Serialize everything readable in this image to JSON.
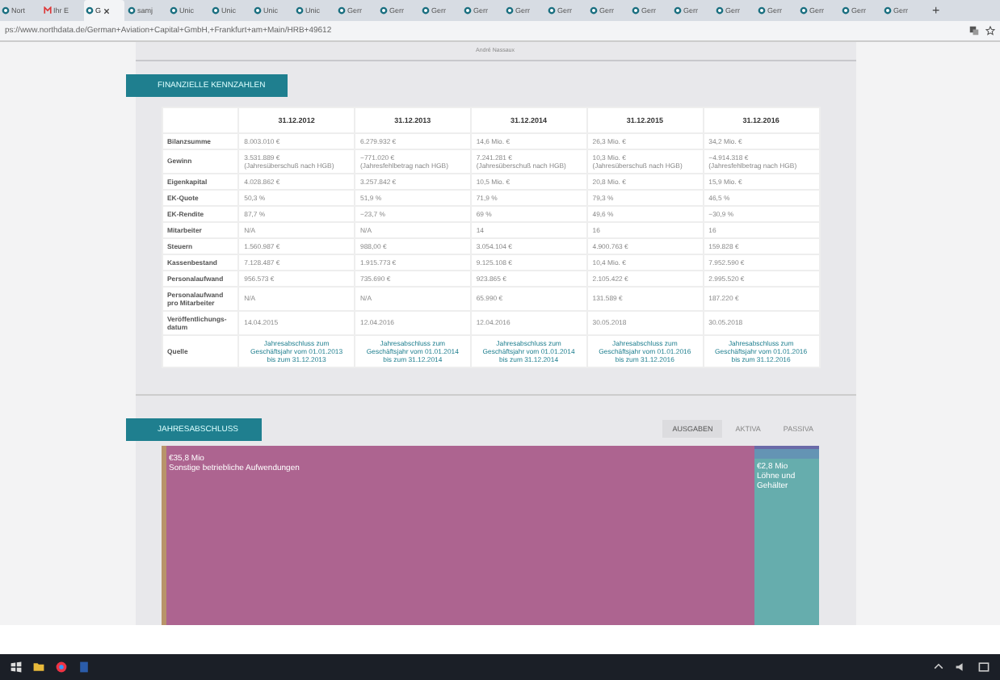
{
  "browser": {
    "tabs": [
      {
        "title": "Nort",
        "kind": "site",
        "selected": false
      },
      {
        "title": "Ihr E",
        "kind": "mail",
        "selected": false
      },
      {
        "title": "G",
        "kind": "site",
        "selected": true
      },
      {
        "title": "samj",
        "kind": "site",
        "selected": false
      },
      {
        "title": "Unic",
        "kind": "site",
        "selected": false
      },
      {
        "title": "Unic",
        "kind": "site",
        "selected": false
      },
      {
        "title": "Unic",
        "kind": "site",
        "selected": false
      },
      {
        "title": "Unic",
        "kind": "site",
        "selected": false
      },
      {
        "title": "Gerr",
        "kind": "site",
        "selected": false
      },
      {
        "title": "Gerr",
        "kind": "site",
        "selected": false
      },
      {
        "title": "Gerr",
        "kind": "site",
        "selected": false
      },
      {
        "title": "Gerr",
        "kind": "site",
        "selected": false
      },
      {
        "title": "Gerr",
        "kind": "site",
        "selected": false
      },
      {
        "title": "Gerr",
        "kind": "site",
        "selected": false
      },
      {
        "title": "Gerr",
        "kind": "site",
        "selected": false
      },
      {
        "title": "Gerr",
        "kind": "site",
        "selected": false
      },
      {
        "title": "Gerr",
        "kind": "site",
        "selected": false
      },
      {
        "title": "Gerr",
        "kind": "site",
        "selected": false
      },
      {
        "title": "Gerr",
        "kind": "site",
        "selected": false
      },
      {
        "title": "Gerr",
        "kind": "site",
        "selected": false
      },
      {
        "title": "Gerr",
        "kind": "site",
        "selected": false
      },
      {
        "title": "Gerr",
        "kind": "site",
        "selected": false
      }
    ],
    "new_tab": "+",
    "url": "ps://www.northdata.de/German+Aviation+Capital+GmbH,+Frankfurt+am+Main/HRB+49612"
  },
  "top_caption": "André Nassaux",
  "financials": {
    "title": "FINANZIELLE KENNZAHLEN",
    "columns": [
      "31.12.2012",
      "31.12.2013",
      "31.12.2014",
      "31.12.2015",
      "31.12.2016"
    ],
    "rows": [
      {
        "label": "Bilanzsumme",
        "kind": "text",
        "cells": [
          "8.003.010 €",
          "6.279.932 €",
          "14,6 Mio. €",
          "26,3 Mio. €",
          "34,2 Mio. €"
        ]
      },
      {
        "label": "Gewinn",
        "kind": "text",
        "cells": [
          "3.531.889 €\n(Jahresüberschuß nach HGB)",
          "−771.020 €\n(Jahresfehlbetrag nach HGB)",
          "7.241.281 €\n(Jahresüberschuß nach HGB)",
          "10,3 Mio. €\n(Jahresüberschuß nach HGB)",
          "−4.914.318 €\n(Jahresfehlbetrag nach HGB)"
        ]
      },
      {
        "label": "Eigenkapital",
        "kind": "text",
        "cells": [
          "4.028.862 €",
          "3.257.842 €",
          "10,5 Mio. €",
          "20,8 Mio. €",
          "15,9 Mio. €"
        ]
      },
      {
        "label": "EK-Quote",
        "kind": "text",
        "cells": [
          "50,3 %",
          "51,9 %",
          "71,9 %",
          "79,3 %",
          "46,5 %"
        ]
      },
      {
        "label": "EK-Rendite",
        "kind": "text",
        "cells": [
          "87,7 %",
          "−23,7 %",
          "69 %",
          "49,6 %",
          "−30,9 %"
        ]
      },
      {
        "label": "Mitarbeiter",
        "kind": "text",
        "cells": [
          "N/A",
          "N/A",
          "14",
          "16",
          "16"
        ]
      },
      {
        "label": "Steuern",
        "kind": "text",
        "cells": [
          "1.560.987 €",
          "988,00 €",
          "3.054.104 €",
          "4.900.763 €",
          "159.828 €"
        ]
      },
      {
        "label": "Kassenbestand",
        "kind": "text",
        "cells": [
          "7.128.487 €",
          "1.915.773 €",
          "9.125.108 €",
          "10,4 Mio. €",
          "7.952.590 €"
        ]
      },
      {
        "label": "Personalaufwand",
        "kind": "text",
        "cells": [
          "956.573 €",
          "735.690 €",
          "923.865 €",
          "2.105.422 €",
          "2.995.520 €"
        ]
      },
      {
        "label": "Personalaufwand\npro Mitarbeiter",
        "kind": "text",
        "cells": [
          "N/A",
          "N/A",
          "65.990 €",
          "131.589 €",
          "187.220 €"
        ]
      },
      {
        "label": "Veröffentlichungs-\ndatum",
        "kind": "text",
        "cells": [
          "14.04.2015",
          "12.04.2016",
          "12.04.2016",
          "30.05.2018",
          "30.05.2018"
        ]
      },
      {
        "label": "Quelle",
        "kind": "link",
        "cells": [
          "Jahresabschluss zum\nGeschäftsjahr vom 01.01.2013\nbis zum 31.12.2013",
          "Jahresabschluss zum\nGeschäftsjahr vom 01.01.2014\nbis zum 31.12.2014",
          "Jahresabschluss zum\nGeschäftsjahr vom 01.01.2014\nbis zum 31.12.2014",
          "Jahresabschluss zum\nGeschäftsjahr vom 01.01.2016\nbis zum 31.12.2016",
          "Jahresabschluss zum\nGeschäftsjahr vom 01.01.2016\nbis zum 31.12.2016"
        ]
      }
    ]
  },
  "annual_report": {
    "title": "JAHRESABSCHLUSS",
    "views": [
      {
        "label": "AUSGABEN",
        "selected": true
      },
      {
        "label": "AKTIVA",
        "selected": false
      },
      {
        "label": "PASSIVA",
        "selected": false
      }
    ],
    "treemap": {
      "main": {
        "amount": "€35,8 Mio",
        "label": "Sonstige betriebliche Aufwendungen",
        "color": "#ad6490"
      },
      "side": {
        "amount": "€2,8 Mio",
        "label": "Löhne und\nGehälter",
        "color": "#66adad"
      },
      "strips": [
        {
          "color": "#b8946a"
        },
        {
          "color": "#6a6aa8"
        },
        {
          "color": "#6494b4"
        }
      ]
    }
  }
}
